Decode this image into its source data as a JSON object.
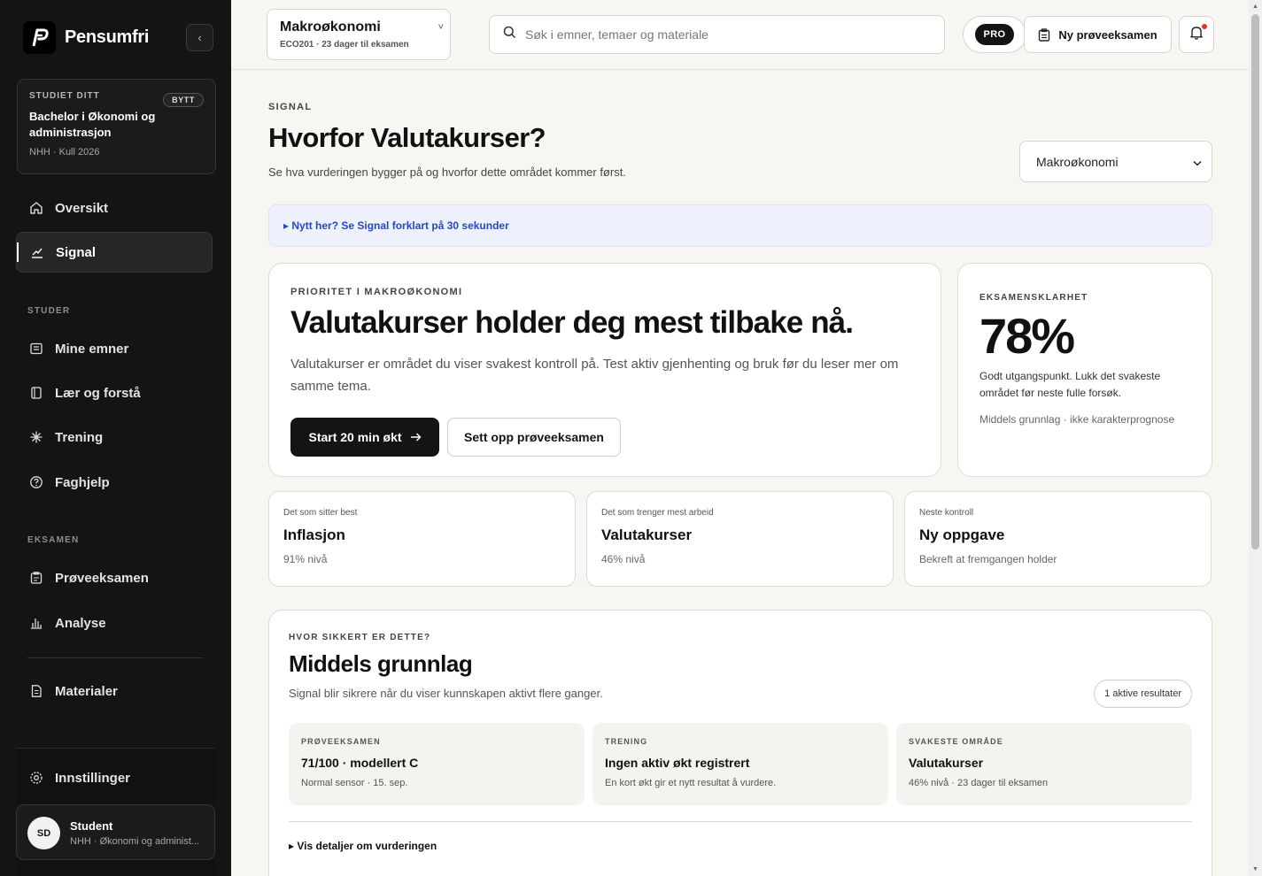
{
  "sidebar": {
    "brand": "Pensumfri",
    "study": {
      "kicker": "STUDIET DITT",
      "swap_label": "BYTT",
      "name": "Bachelor i Økonomi og administrasjon",
      "meta": "NHH · Kull 2026"
    },
    "nav": {
      "overview": "Oversikt",
      "signal": "Signal",
      "section_study": "STUDER",
      "my_courses": "Mine emner",
      "learn": "Lær og forstå",
      "training": "Trening",
      "help": "Faghjelp",
      "section_exam": "EKSAMEN",
      "mock_exam": "Prøveeksamen",
      "analysis": "Analyse",
      "materials": "Materialer",
      "settings": "Innstillinger"
    },
    "user": {
      "initials": "SD",
      "name": "Student",
      "meta": "NHH · Økonomi og administ..."
    }
  },
  "topbar": {
    "course": {
      "title": "Makroøkonomi",
      "meta": "ECO201 · 23 dager til eksamen"
    },
    "search_placeholder": "Søk i emner, temaer og materiale",
    "pro_label": "PRO",
    "new_exam_label": "Ny prøveeksamen"
  },
  "page": {
    "kicker": "SIGNAL",
    "title": "Hvorfor Valutakurser?",
    "subtitle": "Se hva vurderingen bygger på og hvorfor dette området kommer først.",
    "subject_select": "Makroøkonomi",
    "intro_banner": "▸ Nytt her? Se Signal forklart på 30 sekunder"
  },
  "hero": {
    "kicker": "PRIORITET I MAKROØKONOMI",
    "title": "Valutakurser holder deg mest tilbake nå.",
    "text": "Valutakurser er området du viser svakest kontroll på. Test aktiv gjenhenting og bruk før du leser mer om samme tema.",
    "primary_label": "Start 20 min økt",
    "secondary_label": "Sett opp prøveeksamen"
  },
  "clarity": {
    "kicker": "EKSAMENSKLARHET",
    "value": "78%",
    "text": "Godt utgangspunkt. Lukk det svakeste området før neste fulle forsøk.",
    "meta": "Middels grunnlag · ikke karakterprognose"
  },
  "stats": [
    {
      "label": "Det som sitter best",
      "value": "Inflasjon",
      "sub": "91% nivå"
    },
    {
      "label": "Det som trenger mest arbeid",
      "value": "Valutakurser",
      "sub": "46% nivå"
    },
    {
      "label": "Neste kontroll",
      "value": "Ny oppgave",
      "sub": "Bekreft at fremgangen holder"
    }
  ],
  "certainty": {
    "kicker": "HVOR SIKKERT ER DETTE?",
    "title": "Middels grunnlag",
    "subtitle": "Signal blir sikrere når du viser kunnskapen aktivt flere ganger.",
    "active_results": "1 aktive resultater",
    "tiles": [
      {
        "kicker": "PRØVEEKSAMEN",
        "value": "71/100 · modellert C",
        "sub": "Normal sensor · 15. sep."
      },
      {
        "kicker": "TRENING",
        "value": "Ingen aktiv økt registrert",
        "sub": "En kort økt gir et nytt resultat å vurdere."
      },
      {
        "kicker": "SVAKESTE OMRÅDE",
        "value": "Valutakurser",
        "sub": "46% nivå · 23 dager til eksamen"
      }
    ],
    "details_label": "▸ Vis detaljer om vurderingen"
  }
}
